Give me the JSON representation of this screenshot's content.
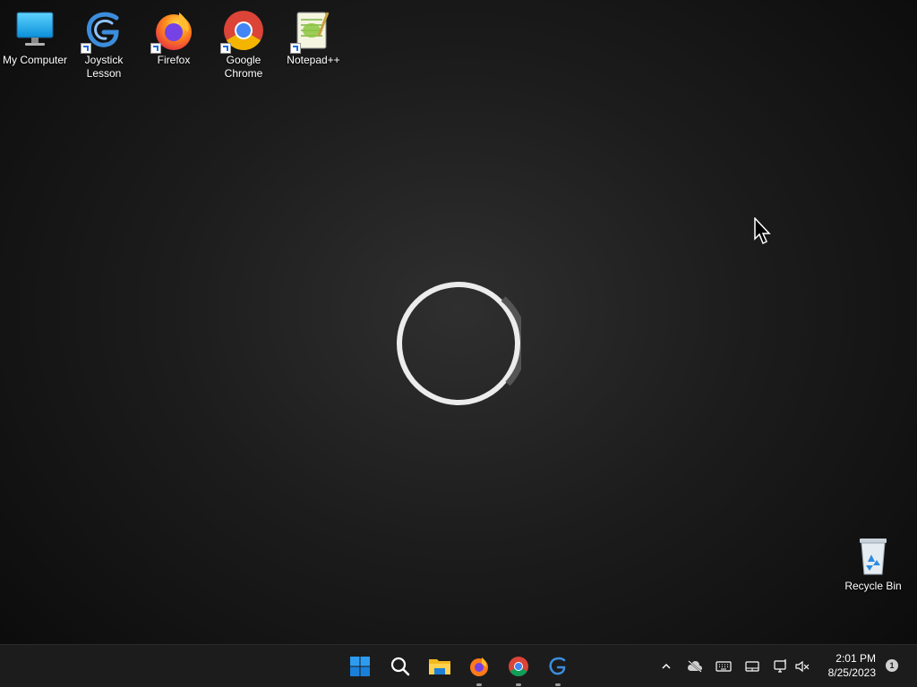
{
  "desktop": {
    "icons": [
      {
        "label": "My Computer",
        "icon": "computer-icon",
        "shortcut": false
      },
      {
        "label": "Joystick Lesson",
        "icon": "gdevelop-icon",
        "shortcut": true
      },
      {
        "label": "Firefox",
        "icon": "firefox-icon",
        "shortcut": true
      },
      {
        "label": "Google Chrome",
        "icon": "chrome-icon",
        "shortcut": true
      },
      {
        "label": "Notepad++",
        "icon": "notepadpp-icon",
        "shortcut": true
      }
    ],
    "recycle_bin": {
      "label": "Recycle Bin",
      "icon": "recycle-bin-icon"
    }
  },
  "loading": {
    "icon": "loading-spinner"
  },
  "taskbar": {
    "pinned": [
      {
        "icon": "start-icon",
        "running": false
      },
      {
        "icon": "search-icon",
        "running": false
      },
      {
        "icon": "file-explorer-icon",
        "running": false
      },
      {
        "icon": "firefox-icon",
        "running": true
      },
      {
        "icon": "chrome-icon",
        "running": true
      },
      {
        "icon": "gdevelop-icon",
        "running": true
      }
    ],
    "tray": {
      "icons": [
        "chevron-up-icon",
        "onedrive-offline-icon",
        "keyboard-icon",
        "touchpad-icon",
        "network-icon",
        "volume-muted-icon"
      ],
      "time": "2:01 PM",
      "date": "8/25/2023",
      "notifications": "1"
    }
  },
  "colors": {
    "taskbar": "#1c1c1c",
    "accent": "#0078d4"
  }
}
